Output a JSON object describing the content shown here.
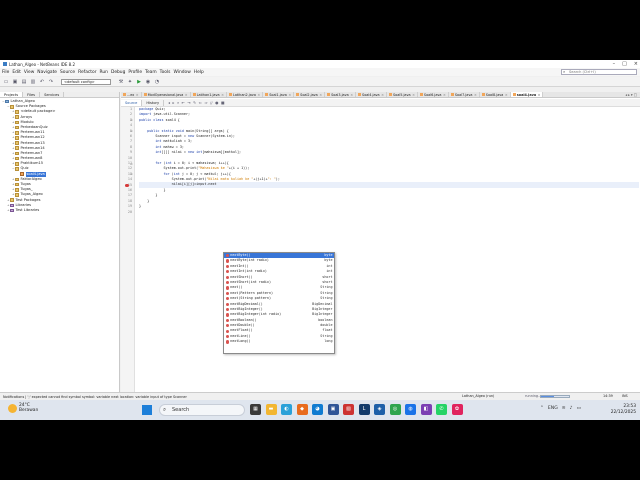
{
  "window": {
    "title": "Lathan_Algeo - NetBeans IDE 8.2"
  },
  "menu": [
    "File",
    "Edit",
    "View",
    "Navigate",
    "Source",
    "Refactor",
    "Run",
    "Debug",
    "Profile",
    "Team",
    "Tools",
    "Window",
    "Help"
  ],
  "search": {
    "placeholder": "Search (Ctrl+I)"
  },
  "toolbar": {
    "config": "<default config>"
  },
  "project_panel": {
    "tabs": [
      "Projects",
      "Files",
      "Services"
    ],
    "tree": [
      {
        "label": "Lathan_Algeo",
        "indent": 0,
        "type": "proj",
        "twisty": "−"
      },
      {
        "label": "Source Packages",
        "indent": 1,
        "type": "folder",
        "twisty": "−"
      },
      {
        "label": "<default package>",
        "indent": 2,
        "type": "folder",
        "twisty": "+"
      },
      {
        "label": "Arrays",
        "indent": 2,
        "type": "folder",
        "twisty": "+"
      },
      {
        "label": "Modulo",
        "indent": 2,
        "type": "folder",
        "twisty": "+"
      },
      {
        "label": "PerbedaanQuiz",
        "indent": 2,
        "type": "folder",
        "twisty": "+"
      },
      {
        "label": "Pertemuan11",
        "indent": 2,
        "type": "folder",
        "twisty": "+"
      },
      {
        "label": "Pertemuan12",
        "indent": 2,
        "type": "folder",
        "twisty": "+"
      },
      {
        "label": "Pertemuan13",
        "indent": 2,
        "type": "folder",
        "twisty": "+"
      },
      {
        "label": "Pertemuan14",
        "indent": 2,
        "type": "folder",
        "twisty": "+"
      },
      {
        "label": "Pertemuan7",
        "indent": 2,
        "type": "folder",
        "twisty": "+"
      },
      {
        "label": "Pertemuan8",
        "indent": 2,
        "type": "folder",
        "twisty": "+"
      },
      {
        "label": "Praktikum15",
        "indent": 2,
        "type": "folder",
        "twisty": "+"
      },
      {
        "label": "Quiz",
        "indent": 2,
        "type": "folder",
        "twisty": "−"
      },
      {
        "label": "soal4.java",
        "indent": 3,
        "type": "java",
        "twisty": "",
        "selected": true
      },
      {
        "label": "FaktorAlgeo",
        "indent": 2,
        "type": "folder",
        "twisty": "+"
      },
      {
        "label": "Tugas",
        "indent": 2,
        "type": "folder",
        "twisty": "+"
      },
      {
        "label": "Tugas_",
        "indent": 2,
        "type": "folder",
        "twisty": "+"
      },
      {
        "label": "Tugas_Algeo",
        "indent": 2,
        "type": "folder",
        "twisty": "+"
      },
      {
        "label": "Test Packages",
        "indent": 1,
        "type": "folder",
        "twisty": "+"
      },
      {
        "label": "Libraries",
        "indent": 1,
        "type": "lib",
        "twisty": "+"
      },
      {
        "label": "Test Libraries",
        "indent": 1,
        "type": "lib",
        "twisty": "+"
      }
    ]
  },
  "editor": {
    "tabs": [
      {
        "label": "...ex"
      },
      {
        "label": "ModOperasional.java"
      },
      {
        "label": "Latihan1.java"
      },
      {
        "label": "Latihan2.java"
      },
      {
        "label": "Soal1.java"
      },
      {
        "label": "Soal2.java"
      },
      {
        "label": "Soal3.java"
      },
      {
        "label": "Soal4.java"
      },
      {
        "label": "Soal5.java"
      },
      {
        "label": "Soal6.java"
      },
      {
        "label": "Soal7.java"
      },
      {
        "label": "Soal8.java"
      },
      {
        "label": "soal4.java",
        "active": true
      }
    ],
    "subtabs": [
      "Source",
      "History"
    ],
    "lines": [
      {
        "n": "1",
        "html": "<span class='kw'>package</span> Quiz;"
      },
      {
        "n": "2",
        "html": "<span class='kw'>import</span> java.util.Scanner;"
      },
      {
        "n": "3",
        "html": "<span class='kw'>public class</span> soal4 {"
      },
      {
        "n": "4",
        "html": ""
      },
      {
        "n": "5",
        "html": "    <span class='kw'>public static void</span> main(String[] args) {"
      },
      {
        "n": "6",
        "html": "        Scanner input = <span class='kw'>new</span> Scanner(System.in);"
      },
      {
        "n": "7",
        "html": "        <span class='kw'>int</span> matkuliah = 3;"
      },
      {
        "n": "8",
        "html": "        <span class='kw'>int</span> mahsw = 3;"
      },
      {
        "n": "9",
        "html": "        <span class='kw'>int</span>[][] nilai = <span class='kw'>new int</span>[mahsiswa][matkul];"
      },
      {
        "n": "10",
        "html": ""
      },
      {
        "n": "11",
        "html": "        <span class='kw'>for</span> (<span class='kw'>int</span> i = 0; i &lt; mahasiswa; i++){"
      },
      {
        "n": "12",
        "html": "            System.out.print(<span class='str'>\"Mahasiswa ke \"</span>+(i + 1));"
      },
      {
        "n": "13",
        "html": "            <span class='kw'>for</span> (<span class='kw'>int</span> j = 0; j &lt; matkul; j++){"
      },
      {
        "n": "14",
        "html": "                System.out.print(<span class='str'>\"Nilai mata kuliah ke \"</span>+(j+1)+<span class='str'>\": \"</span>);"
      },
      {
        "n": "15",
        "html": "                nilai[i][j]=input.next",
        "current": true,
        "error": true
      },
      {
        "n": "16",
        "html": "            }"
      },
      {
        "n": "17",
        "html": "        }"
      },
      {
        "n": "18",
        "html": "    }"
      },
      {
        "n": "19",
        "html": "}"
      },
      {
        "n": "20",
        "html": ""
      }
    ]
  },
  "completion": [
    {
      "sig": "nextByte()",
      "ret": "byte",
      "selected": true
    },
    {
      "sig": "nextByte(int radix)",
      "ret": "byte"
    },
    {
      "sig": "nextInt()",
      "ret": "int"
    },
    {
      "sig": "nextInt(int radix)",
      "ret": "int"
    },
    {
      "sig": "nextShort()",
      "ret": "short"
    },
    {
      "sig": "nextShort(int radix)",
      "ret": "short"
    },
    {
      "sig": "next()",
      "ret": "String"
    },
    {
      "sig": "next(Pattern pattern)",
      "ret": "String"
    },
    {
      "sig": "next(String pattern)",
      "ret": "String"
    },
    {
      "sig": "nextBigDecimal()",
      "ret": "BigDecimal"
    },
    {
      "sig": "nextBigInteger()",
      "ret": "BigInteger"
    },
    {
      "sig": "nextBigInteger(int radix)",
      "ret": "BigInteger"
    },
    {
      "sig": "nextBoolean()",
      "ret": "boolean"
    },
    {
      "sig": "nextDouble()",
      "ret": "double"
    },
    {
      "sig": "nextFloat()",
      "ret": "float"
    },
    {
      "sig": "nextLine()",
      "ret": "String"
    },
    {
      "sig": "nextLong()",
      "ret": "long"
    }
  ],
  "status": {
    "message": "Notifications  |  ';' expected  cannot find symbol  symbol: variable next  location: variable input of type Scanner",
    "project": "Lathan_Algeo (run)",
    "running": "running...",
    "progress": 0.45,
    "position": "14:39",
    "insert": "INS"
  },
  "taskbar": {
    "temp": "24°C",
    "weather": "Berawan",
    "search": "Search",
    "tray": [
      "ENG"
    ],
    "time": "23:53",
    "date": "22/12/2025"
  },
  "colors": {
    "selection": "#3875d7",
    "keyword": "#1a3ea8",
    "string": "#ce7b00",
    "error": "#d63b3b"
  }
}
